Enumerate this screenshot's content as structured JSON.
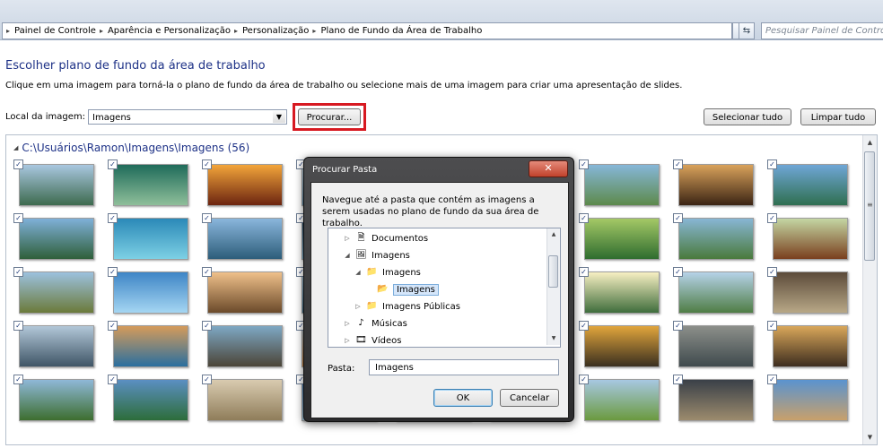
{
  "address_bar": {
    "breadcrumbs": [
      "Painel de Controle",
      "Aparência e Personalização",
      "Personalização",
      "Plano de Fundo da Área de Trabalho"
    ],
    "search_placeholder": "Pesquisar Painel de Controle"
  },
  "page": {
    "title": "Escolher plano de fundo da área de trabalho",
    "description": "Clique em uma imagem para torná-la o plano de fundo da área de trabalho ou selecione mais de uma imagem para criar uma apresentação de slides.",
    "location_label": "Local da imagem:",
    "location_value": "Imagens",
    "browse_button": "Procurar...",
    "select_all_button": "Selecionar tudo",
    "clear_all_button": "Limpar tudo"
  },
  "gallery": {
    "path": "C:\\Usuários\\Ramon\\Imagens\\Imagens (56)",
    "check_mark": "✓",
    "thumbnails": [
      [
        "#a9c7e0",
        "#3d6a4e"
      ],
      [
        "#1f6b5a",
        "#8fbf9a"
      ],
      [
        "#f3a53a",
        "#6b2410"
      ],
      [
        "#cfe3f2",
        "#5f8fb0"
      ],
      [
        "#6aa0c8",
        "#2d5a2f"
      ],
      [
        "#f2f4f6",
        "#b8c6cf"
      ],
      [
        "#86b7d8",
        "#5d8a4b"
      ],
      [
        "#d9a25b",
        "#3b2414"
      ],
      [
        "#6fa6d6",
        "#2f6f50"
      ],
      [
        "#7fb0d8",
        "#2f5f3a"
      ],
      [
        "#2b89b8",
        "#7dd0e4"
      ],
      [
        "#8ab6dc",
        "#2d5d7a"
      ],
      [
        "#1c3f5e",
        "#7cb4d6"
      ],
      [
        "#c9d7c2",
        "#6b7f4d"
      ],
      [
        "#9bbfd8",
        "#3f6a3b"
      ],
      [
        "#a4c866",
        "#2f6d2f"
      ],
      [
        "#88b6d4",
        "#4a7a3c"
      ],
      [
        "#c4d6a3",
        "#7a3f1e"
      ],
      [
        "#9cc1de",
        "#6b7a3a"
      ],
      [
        "#3e85c6",
        "#a5d6f2"
      ],
      [
        "#efc08a",
        "#6b4a2a"
      ],
      [
        "#a8cce6",
        "#3d6e8d"
      ],
      [
        "#c3d2de",
        "#55728a"
      ],
      [
        "#c9b27a",
        "#2a4a2f"
      ],
      [
        "#f7efc2",
        "#3f6d3c"
      ],
      [
        "#b5d2e8",
        "#4f7d45"
      ],
      [
        "#5c4b3a",
        "#b8a887"
      ],
      [
        "#b2c7d8",
        "#3f5566"
      ],
      [
        "#d59b5a",
        "#2a6f9f"
      ],
      [
        "#7ea8c4",
        "#4b4437"
      ],
      [
        "#a8c0d3",
        "#d4843a"
      ],
      [
        "#3c4a63",
        "#d6a35a"
      ],
      [
        "#b9cfe2",
        "#47705a"
      ],
      [
        "#e1a53c",
        "#3a2f1f"
      ],
      [
        "#8c8f8a",
        "#3f4a4d"
      ],
      [
        "#d9a75a",
        "#3d2d1f"
      ],
      [
        "#8fb8d8",
        "#3d6e2f"
      ],
      [
        "#5b8fc2",
        "#2d6d3a"
      ],
      [
        "#d9cbb0",
        "#8f7d5a"
      ],
      [
        "#3f79b8",
        "#9fc5dc"
      ],
      [
        "#4a6f8f",
        "#2a3a45"
      ],
      [
        "#8fb8d8",
        "#4d7d3c"
      ],
      [
        "#a7c8e2",
        "#6b9a3f"
      ],
      [
        "#3a4048",
        "#9c8b6d"
      ],
      [
        "#5a93cf",
        "#c8a06b"
      ]
    ]
  },
  "dialog": {
    "title": "Procurar Pasta",
    "close_glyph": "✕",
    "instruction": "Navegue até a pasta que contém as imagens a serem usadas no plano de fundo da sua área de trabalho.",
    "tree": [
      {
        "label": "Documentos",
        "expander": "▷",
        "icon": "documents-icon",
        "glyph": "🗎",
        "level": 0,
        "selected": false
      },
      {
        "label": "Imagens",
        "expander": "◢",
        "icon": "pictures-icon",
        "glyph": "🖼",
        "level": 0,
        "selected": false
      },
      {
        "label": "Imagens",
        "expander": "◢",
        "icon": "folder-icon",
        "glyph": "📁",
        "level": 1,
        "selected": false
      },
      {
        "label": "Imagens",
        "expander": "",
        "icon": "folder-icon",
        "glyph": "📂",
        "level": 2,
        "selected": true
      },
      {
        "label": "Imagens Públicas",
        "expander": "▷",
        "icon": "folder-icon",
        "glyph": "📁",
        "level": 1,
        "selected": false
      },
      {
        "label": "Músicas",
        "expander": "▷",
        "icon": "music-icon",
        "glyph": "♪",
        "level": 0,
        "selected": false
      },
      {
        "label": "Vídeos",
        "expander": "▷",
        "icon": "videos-icon",
        "glyph": "🎞",
        "level": 0,
        "selected": false
      }
    ],
    "folder_label": "Pasta:",
    "folder_value": "Imagens",
    "ok_button": "OK",
    "cancel_button": "Cancelar"
  }
}
